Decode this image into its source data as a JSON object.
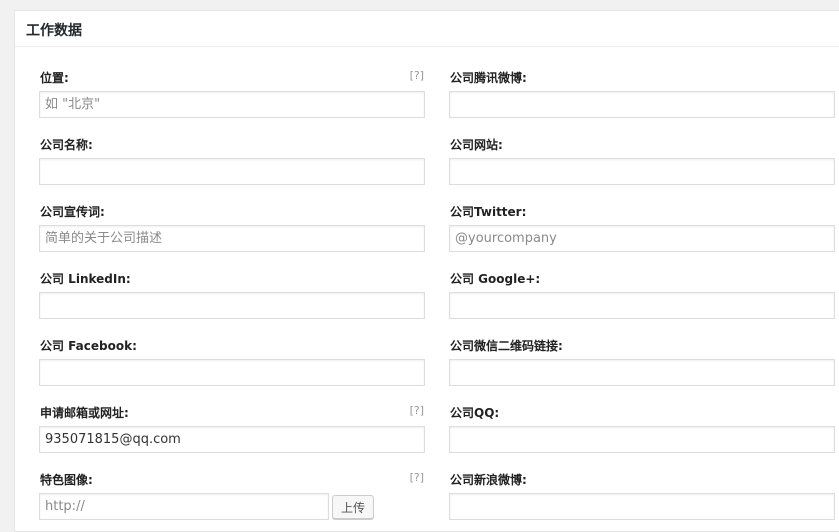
{
  "panel": {
    "title": "工作数据"
  },
  "left_fields": [
    {
      "label": "位置:",
      "help": "[?]",
      "value": "",
      "placeholder": "如 \"北京\""
    },
    {
      "label": "公司名称:",
      "value": "",
      "placeholder": ""
    },
    {
      "label": "公司宣传词:",
      "value": "",
      "placeholder": "简单的关于公司描述"
    },
    {
      "label": "公司 LinkedIn:",
      "value": "",
      "placeholder": ""
    },
    {
      "label": "公司 Facebook:",
      "value": "",
      "placeholder": ""
    },
    {
      "label": "申请邮箱或网址:",
      "help": "[?]",
      "value": "935071815@qq.com",
      "placeholder": ""
    },
    {
      "label": "特色图像:",
      "help": "[?]",
      "value": "",
      "placeholder": "http://",
      "button": "上传"
    }
  ],
  "right_fields": [
    {
      "label": "公司腾讯微博:",
      "value": "",
      "placeholder": ""
    },
    {
      "label": "公司网站:",
      "value": "",
      "placeholder": ""
    },
    {
      "label": "公司Twitter:",
      "value": "",
      "placeholder": "@yourcompany"
    },
    {
      "label": "公司 Google+:",
      "value": "",
      "placeholder": ""
    },
    {
      "label": "公司微信二维码链接:",
      "value": "",
      "placeholder": ""
    },
    {
      "label": "公司QQ:",
      "value": "",
      "placeholder": ""
    },
    {
      "label": "公司新浪微博:",
      "value": "",
      "placeholder": ""
    }
  ]
}
